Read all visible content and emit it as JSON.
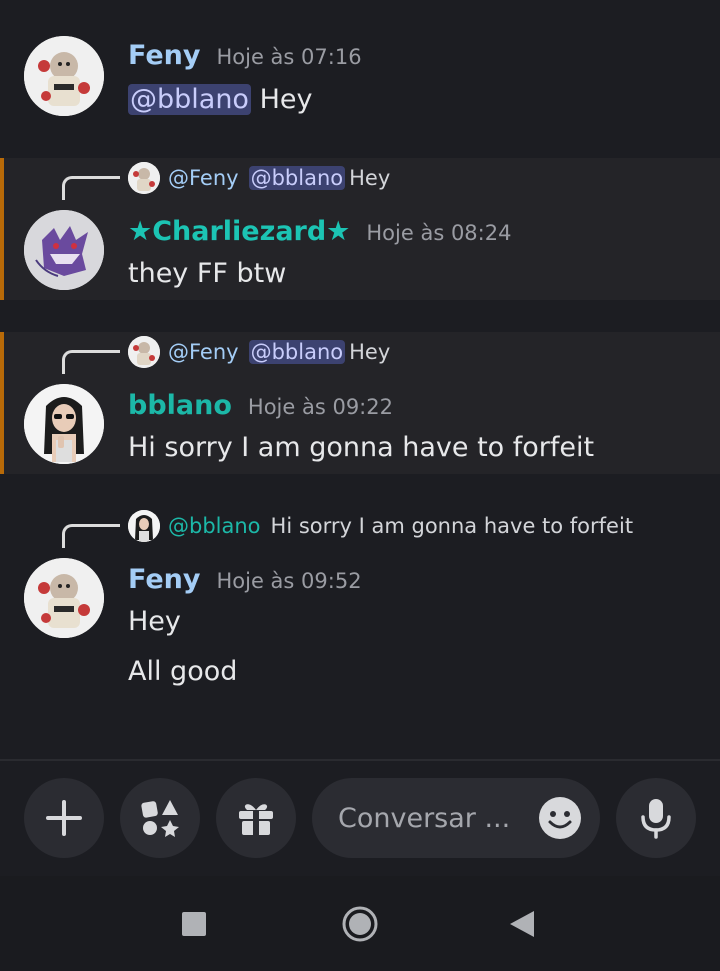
{
  "messages": [
    {
      "author": "Feny",
      "time": "Hoje às 07:16",
      "mention": "@bblano",
      "text": "Hey",
      "author_color": "#a4cdf6"
    },
    {
      "reply": {
        "author": "@Feny",
        "mention": "@bblano",
        "text": "Hey"
      },
      "author": "★Charliezard★",
      "time": "Hoje às 08:24",
      "text": "they FF btw",
      "author_color": "#1cc4b4"
    },
    {
      "reply": {
        "author": "@Feny",
        "mention": "@bblano",
        "text": "Hey"
      },
      "author": "bblano",
      "time": "Hoje às 09:22",
      "text": "Hi sorry I am gonna have to forfeit",
      "author_color": "#1cb8a8"
    },
    {
      "reply": {
        "author": "@bblano",
        "text": "Hi sorry I am gonna have to forfeit"
      },
      "author": "Feny",
      "time": "Hoje às 09:52",
      "lines": [
        "Hey",
        "All good"
      ],
      "author_color": "#a4cdf6"
    }
  ],
  "composer": {
    "placeholder": "Conversar ...",
    "buttons": [
      "plus-icon",
      "apps-icon",
      "gift-icon",
      "emoji-icon",
      "microphone-icon"
    ]
  },
  "navbar": {
    "buttons": [
      "recent-apps-icon",
      "home-icon",
      "back-icon"
    ]
  },
  "colors": {
    "background": "#1c1d22",
    "highlight_bar": "#b86a08",
    "mention_bg": "#3c4270",
    "mention_text": "#c9cdfb",
    "reply_author_feny": "#a4cdf6",
    "reply_author_bblano": "#1cb8a8"
  }
}
